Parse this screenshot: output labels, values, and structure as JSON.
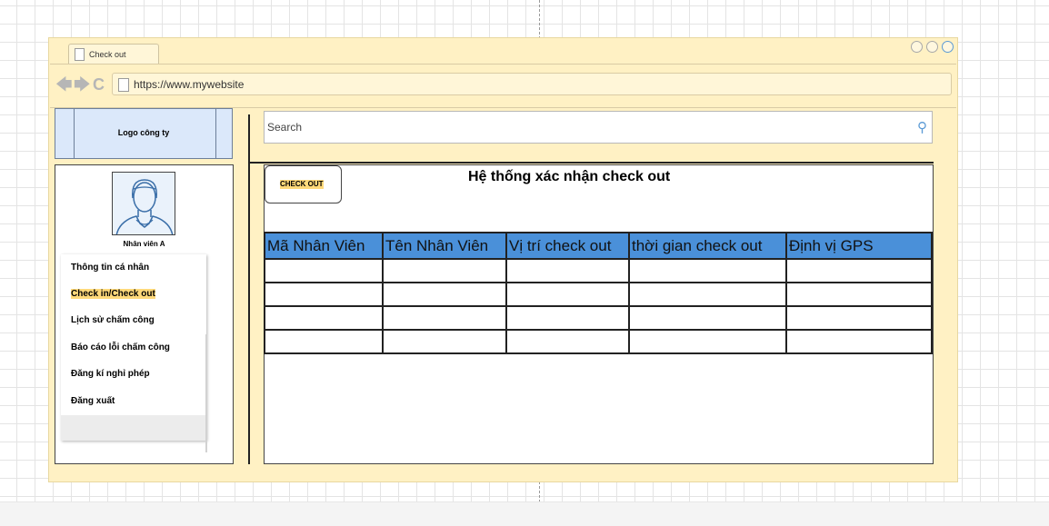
{
  "browser": {
    "tab_title": "Check out",
    "url": "https://www.mywebsite",
    "nav_icons": [
      "arrow-left-icon",
      "arrow-right-icon",
      "reload-icon"
    ],
    "window_controls": 3
  },
  "header": {
    "logo_text": "Logo công ty",
    "search_placeholder": "Search"
  },
  "sidebar": {
    "user_name": "Nhân viên A",
    "active_item": 1,
    "items": [
      {
        "label": "Thông tin cá nhân"
      },
      {
        "label": "Check in/Check out"
      },
      {
        "label": "Lịch sử chấm công"
      },
      {
        "label": "Báo cáo lỗi chấm công"
      },
      {
        "label": "Đăng kí nghỉ phép"
      },
      {
        "label": "Đăng xuất"
      }
    ]
  },
  "main": {
    "checkout_button": "CHECK OUT",
    "title": "Hệ thống xác nhận check out",
    "table": {
      "columns": [
        "Mã Nhân Viên",
        "Tên Nhân Viên",
        "Vị trí check out",
        "thời gian check out",
        "Định vị GPS"
      ],
      "rows": [
        [
          "",
          "",
          "",
          "",
          ""
        ],
        [
          "",
          "",
          "",
          "",
          ""
        ],
        [
          "",
          "",
          "",
          "",
          ""
        ],
        [
          "",
          "",
          "",
          "",
          ""
        ]
      ]
    }
  },
  "colors": {
    "window_bg": "#fff1c4",
    "logo_bg": "#dbe8fa",
    "table_header_bg": "#4a90d9",
    "highlight": "#ffd97a"
  }
}
